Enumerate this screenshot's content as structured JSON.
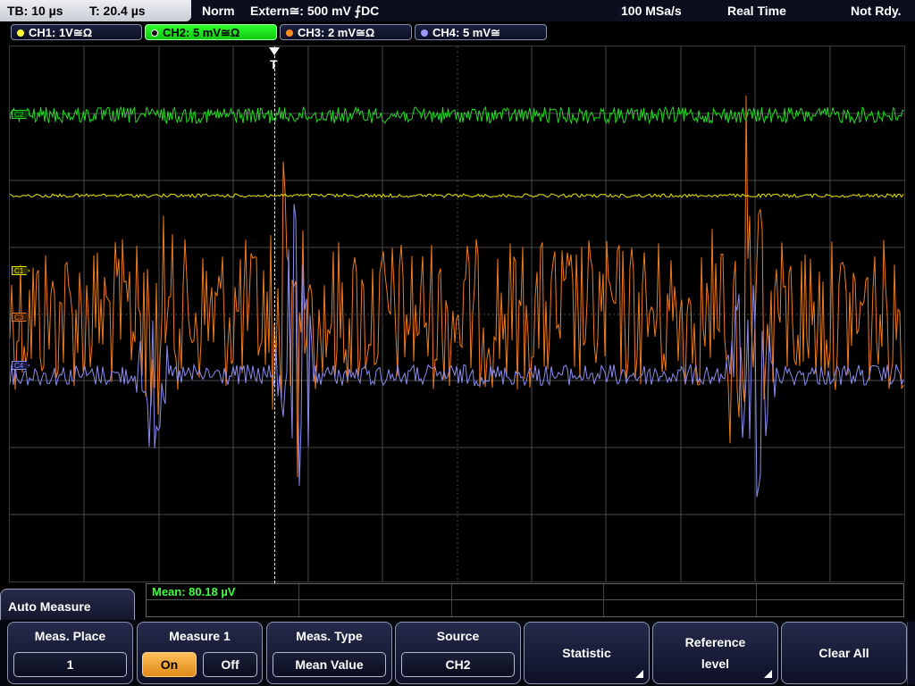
{
  "status_bar": {
    "timebase": "TB: 10 µs",
    "trigger_time": "T: 20.4 µs",
    "acq_mode": "Norm",
    "trigger_info": "Extern≅: 500 mV ⨍DC",
    "sample_rate": "100 MSa/s",
    "mode": "Real Time",
    "state": "Not Rdy."
  },
  "channels": [
    {
      "label": "CH1: 1V≅Ω",
      "color": "#ffff33",
      "active": false
    },
    {
      "label": "CH2: 5 mV≅Ω",
      "color": "#33ff33",
      "active": true
    },
    {
      "label": "CH3: 2 mV≅Ω",
      "color": "#ff8a20",
      "active": false
    },
    {
      "label": "CH4: 5 mV≅",
      "color": "#9a9aff",
      "active": false
    }
  ],
  "waveform": {
    "trigger_label": "T",
    "markers": [
      "C2",
      "C1",
      "C3",
      "C4"
    ],
    "colors": {
      "ch1": "#e8e800",
      "ch2": "#22dd22",
      "ch3": "#f07a1e",
      "ch4": "#8c8cf0",
      "grid": "#4a4a4a"
    }
  },
  "measurement": {
    "result": "Mean: 80.18 µV"
  },
  "menu": {
    "title": "Auto Measure",
    "softkeys": {
      "meas_place": {
        "title": "Meas. Place",
        "value": "1"
      },
      "measure1": {
        "title": "Measure 1",
        "on": "On",
        "off": "Off"
      },
      "meas_type": {
        "title": "Meas. Type",
        "value": "Mean Value"
      },
      "source": {
        "title": "Source",
        "value": "CH2"
      },
      "statistic": {
        "label": "Statistic"
      },
      "reference": {
        "label_line1": "Reference",
        "label_line2": "level"
      },
      "clear_all": {
        "label": "Clear All"
      }
    }
  }
}
